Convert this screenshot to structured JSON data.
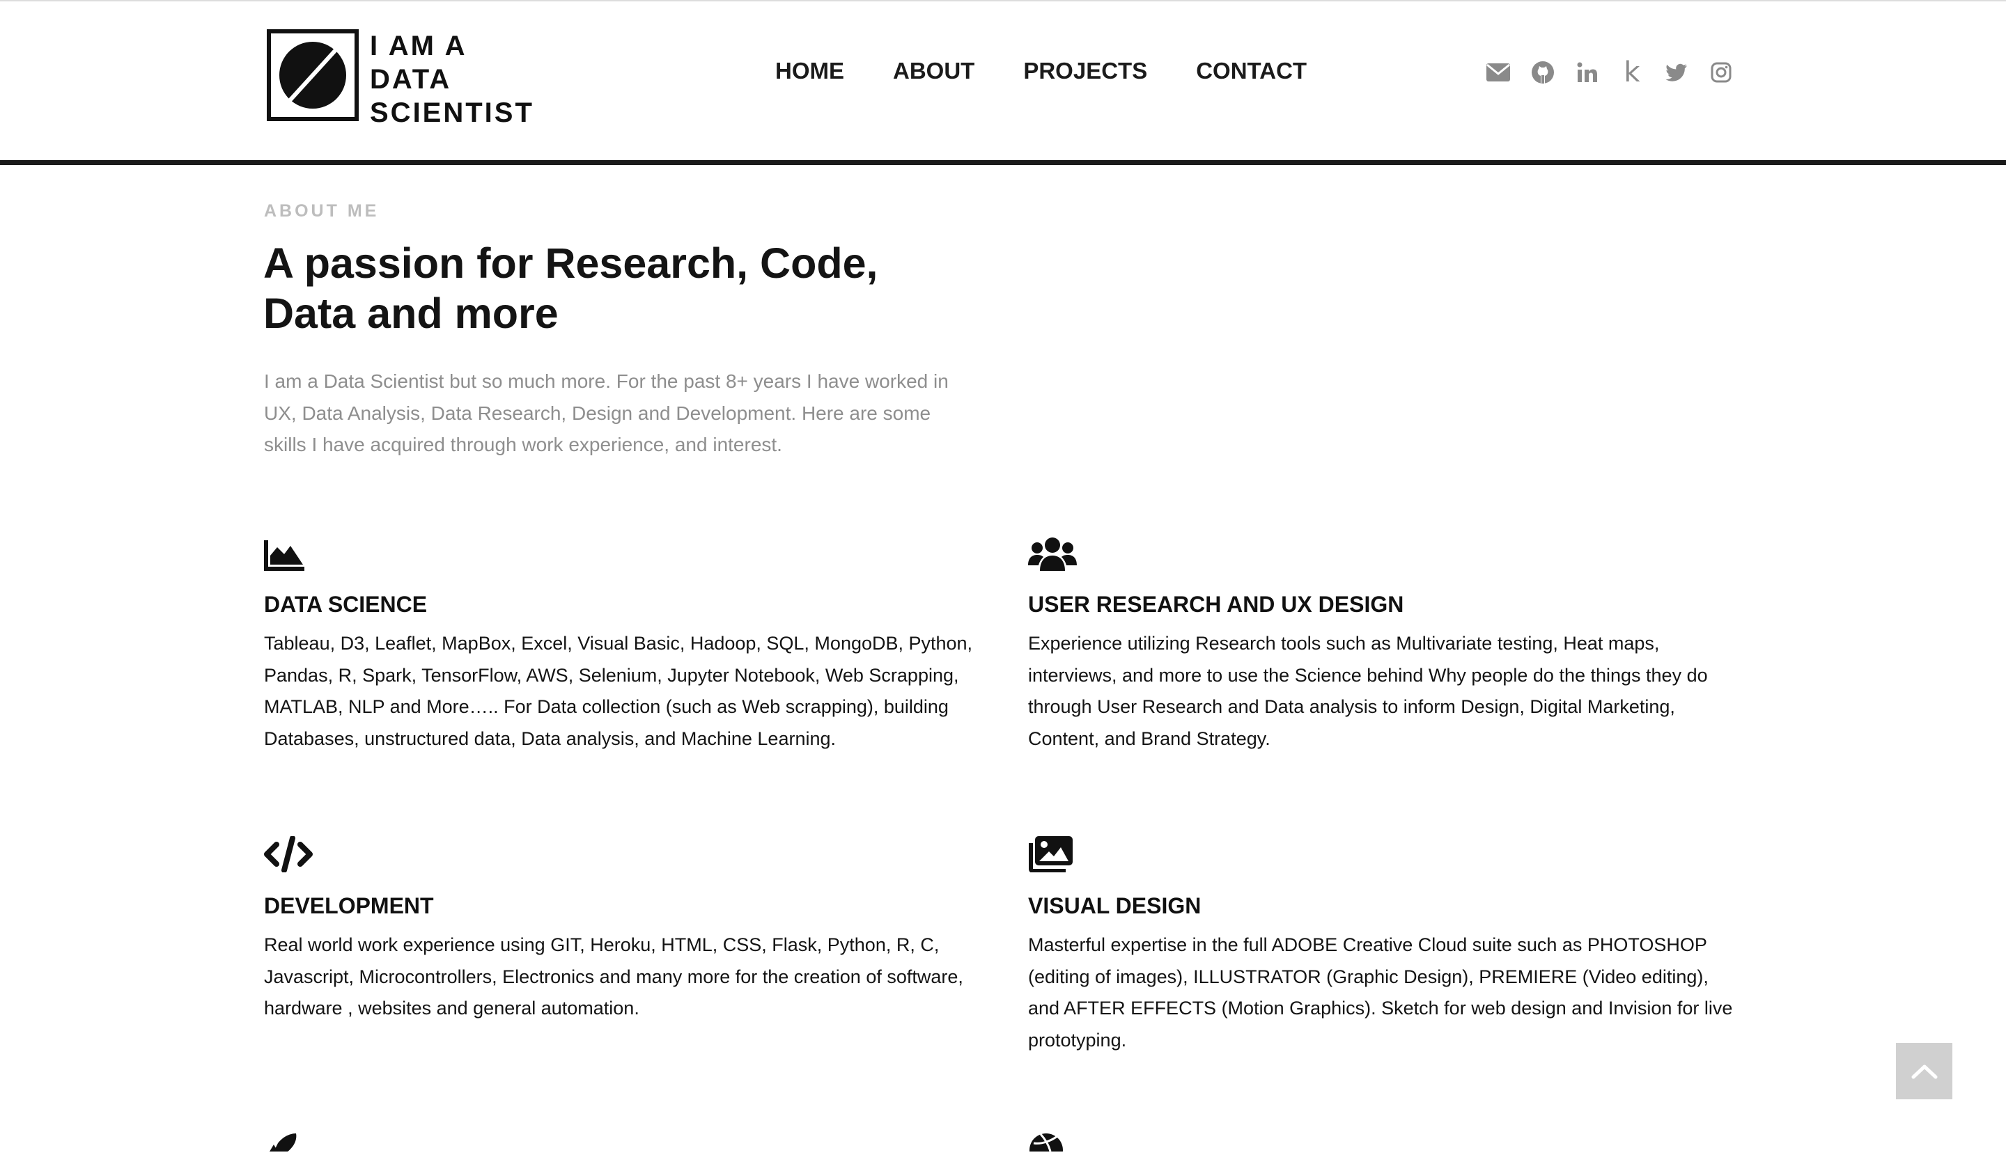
{
  "header": {
    "logo_lines": [
      "I AM A",
      "DATA",
      "SCIENTIST"
    ],
    "nav": [
      "HOME",
      "ABOUT",
      "PROJECTS",
      "CONTACT"
    ],
    "social_icons": [
      "envelope-icon",
      "github-icon",
      "linkedin-icon",
      "kaggle-icon",
      "twitter-icon",
      "instagram-icon"
    ],
    "kaggle_glyph": "k"
  },
  "about": {
    "eyebrow": "ABOUT ME",
    "title": "A passion for Research, Code, Data and more",
    "intro": "I am a Data Scientist but so much more. For the past 8+ years I have worked in UX, Data Analysis, Data Research, Design and Development. Here are some skills I have acquired through work experience, and interest."
  },
  "skills": [
    {
      "icon": "area-chart-icon",
      "title": "DATA SCIENCE",
      "text": "Tableau, D3, Leaflet, MapBox, Excel, Visual Basic, Hadoop, SQL, MongoDB, Python, Pandas, R, Spark, TensorFlow, AWS, Selenium, Jupyter Notebook, Web Scrapping, MATLAB, NLP and More….. For Data collection (such as Web scrapping), building Databases, unstructured data, Data analysis, and Machine Learning."
    },
    {
      "icon": "users-icon",
      "title": "USER RESEARCH AND UX DESIGN",
      "text": "Experience utilizing Research tools such as Multivariate testing, Heat maps, interviews, and more to use the Science behind Why people do the things they do through User Research and Data analysis to inform Design, Digital Marketing, Content, and Brand Strategy."
    },
    {
      "icon": "code-icon",
      "title": "DEVELOPMENT",
      "text": "Real world work experience using GIT, Heroku, HTML, CSS, Flask, Python, R, C, Javascript, Microcontrollers, Electronics and many more for the creation of software, hardware , websites and general automation."
    },
    {
      "icon": "images-icon",
      "title": "VISUAL DESIGN",
      "text": "Masterful expertise in the full ADOBE Creative Cloud suite such as PHOTOSHOP (editing of images), ILLUSTRATOR (Graphic Design), PREMIERE (Video editing), and AFTER EFFECTS (Motion Graphics). Sketch for web design and Invision for live prototyping."
    }
  ],
  "partial_icons": [
    "rocket-icon",
    "dribbble-icon"
  ],
  "back_to_top_icon": "chevron-up-icon",
  "colors": {
    "header_rule": "#1a1a1a",
    "eyebrow": "#bdbdbd",
    "intro_text": "#8e8e8e",
    "social_icon": "#8a8a8a",
    "back_to_top_bg": "#d0d0d0"
  }
}
